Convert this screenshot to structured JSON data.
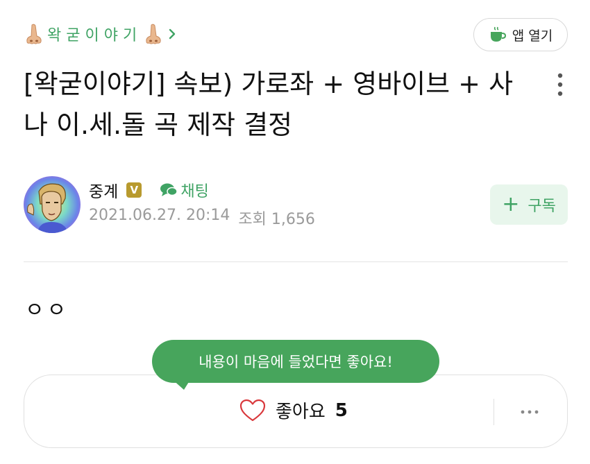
{
  "header": {
    "cafe_name": "왁굳이야기",
    "app_button_label": "앱 열기",
    "colors": {
      "accent": "#3fa364",
      "tooltip": "#47a55c",
      "subscribe_bg": "#e8f6ec"
    }
  },
  "post": {
    "title": "[왁굳이야기] 속보) 가로좌 + 영바이브 + 사나 이.세.돌 곡 제작 결정",
    "author": "중계",
    "author_badge": "V",
    "chat_label": "채팅",
    "date": "2021.06.27. 20:14",
    "views_label": "조회 1,656",
    "subscribe_label": "구독",
    "body": "ㅇㅇ"
  },
  "reaction": {
    "tooltip": "내용이 마음에 들었다면 좋아요!",
    "like_label": "좋아요",
    "like_count": "5"
  },
  "icons": [
    "nose-icon",
    "chevron-right-icon",
    "coffee-cup-icon",
    "more-vertical-icon",
    "chat-bubbles-icon",
    "plus-icon",
    "heart-icon",
    "more-horizontal-icon"
  ]
}
